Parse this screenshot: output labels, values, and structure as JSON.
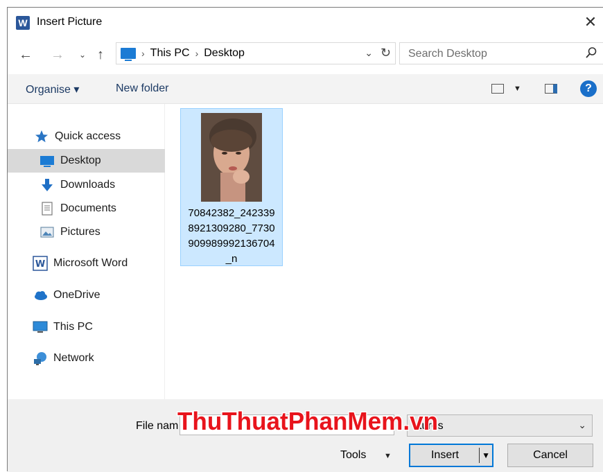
{
  "window": {
    "title": "Insert Picture",
    "app_icon_letter": "W"
  },
  "address": {
    "crumbs": [
      "This PC",
      "Desktop"
    ]
  },
  "search": {
    "placeholder": "Search Desktop"
  },
  "toolbar": {
    "organise_label": "Organise ▾",
    "new_folder_label": "New folder",
    "help_label": "?"
  },
  "nav": {
    "items": [
      {
        "label": "Quick access",
        "icon": "star-icon"
      },
      {
        "label": "Desktop",
        "icon": "desktop-icon",
        "selected": true,
        "pinned": true
      },
      {
        "label": "Downloads",
        "icon": "download-arrow-icon",
        "pinned": true
      },
      {
        "label": "Documents",
        "icon": "document-icon",
        "pinned": true
      },
      {
        "label": "Pictures",
        "icon": "pictures-icon",
        "pinned": true
      },
      {
        "label": "Microsoft Word",
        "icon": "word-icon"
      },
      {
        "label": "OneDrive",
        "icon": "cloud-icon"
      },
      {
        "label": "This PC",
        "icon": "computer-icon"
      },
      {
        "label": "Network",
        "icon": "network-icon"
      }
    ]
  },
  "files": [
    {
      "name": "70842382_2423398921309280_7730909989992136704_n"
    }
  ],
  "bottom": {
    "file_name_label": "File nam",
    "filter_text": "ctures",
    "tools_label": "Tools",
    "insert_label": "Insert",
    "cancel_label": "Cancel"
  },
  "watermark": {
    "text": "ThuThuatPhanMem.vn"
  },
  "colors": {
    "accent": "#0078d7",
    "selection": "#cce8ff",
    "watermark_red": "#e8141c"
  }
}
